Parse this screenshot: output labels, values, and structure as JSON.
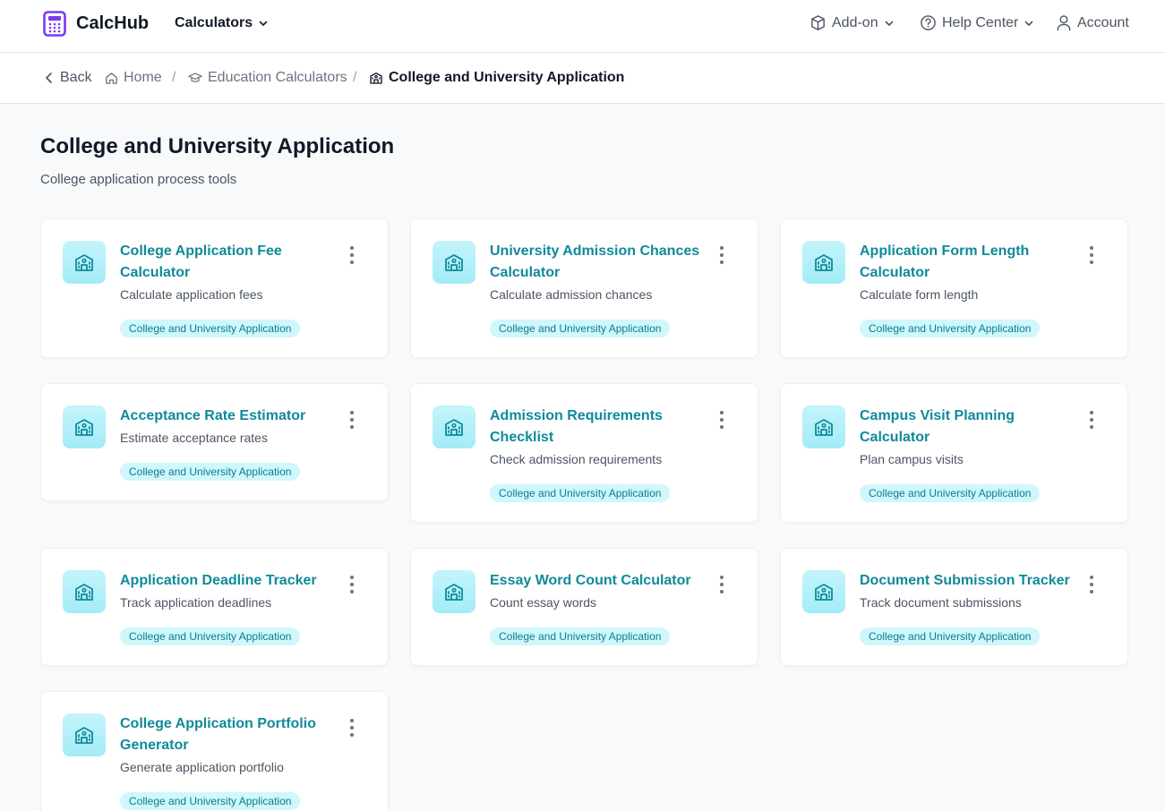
{
  "header": {
    "brand": "CalcHub",
    "nav_calculators": "Calculators",
    "addon": "Add-on",
    "help": "Help Center",
    "account": "Account"
  },
  "breadcrumb": {
    "back": "Back",
    "home": "Home",
    "education": "Education Calculators",
    "current": "College and University Application"
  },
  "page": {
    "title": "College and University Application",
    "subtitle": "College application process tools"
  },
  "cards": [
    {
      "title": "College Application Fee Calculator",
      "description": "Calculate application fees",
      "tag": "College and University Application"
    },
    {
      "title": "University Admission Chances Calculator",
      "description": "Calculate admission chances",
      "tag": "College and University Application"
    },
    {
      "title": "Application Form Length Calculator",
      "description": "Calculate form length",
      "tag": "College and University Application"
    },
    {
      "title": "Acceptance Rate Estimator",
      "description": "Estimate acceptance rates",
      "tag": "College and University Application"
    },
    {
      "title": "Admission Requirements Checklist",
      "description": "Check admission requirements",
      "tag": "College and University Application"
    },
    {
      "title": "Campus Visit Planning Calculator",
      "description": "Plan campus visits",
      "tag": "College and University Application"
    },
    {
      "title": "Application Deadline Tracker",
      "description": "Track application deadlines",
      "tag": "College and University Application"
    },
    {
      "title": "Essay Word Count Calculator",
      "description": "Count essay words",
      "tag": "College and University Application"
    },
    {
      "title": "Document Submission Tracker",
      "description": "Track document submissions",
      "tag": "College and University Application"
    },
    {
      "title": "College Application Portfolio Generator",
      "description": "Generate application portfolio",
      "tag": "College and University Application"
    }
  ],
  "colors": {
    "brand_purple": "#7c3aed",
    "accent_teal": "#0e8a9a",
    "tag_bg": "#cff7fc",
    "icon_bg": "#b6f1f9"
  }
}
